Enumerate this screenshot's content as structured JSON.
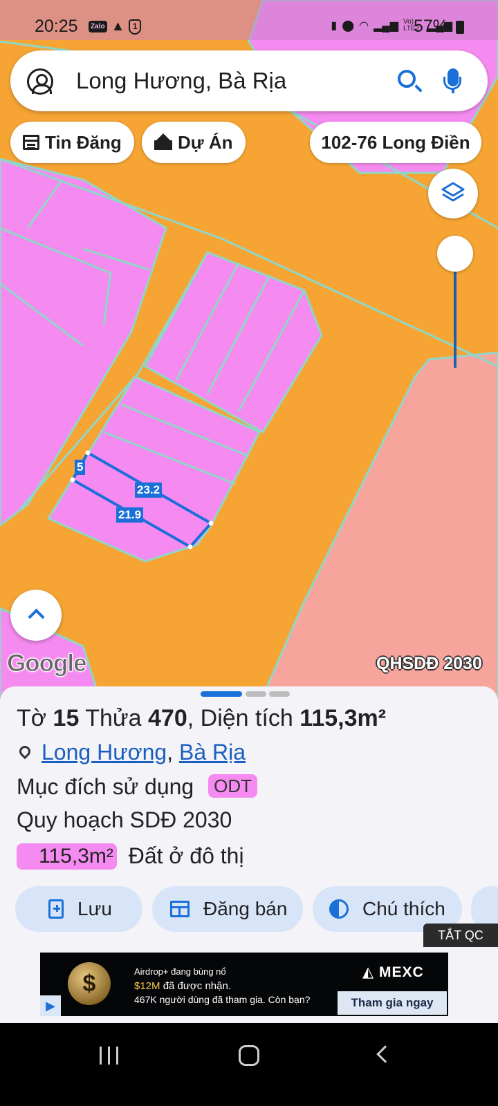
{
  "status_bar": {
    "time": "20:25",
    "app_badge": "Zalo",
    "shield_digit": "1",
    "signal_label": "Vo) LTE2",
    "battery": "57%"
  },
  "search": {
    "query": "Long Hương, Bà Rịa",
    "icons": [
      "account-icon",
      "search-icon",
      "mic-icon"
    ]
  },
  "chips": [
    {
      "label": "Tin Đăng",
      "icon": "calendar-icon"
    },
    {
      "label": "Dự Án",
      "icon": "house-icon"
    },
    {
      "label": "102-76 Long Điền"
    }
  ],
  "map": {
    "overlay_label": "QHSDĐ 2030",
    "google_logo": "Google",
    "measurements": [
      "5",
      "23.2",
      "21.9"
    ],
    "colors": {
      "residential": "#f58bf0",
      "road": "#f6a534",
      "other": "#f7a59c",
      "boundary": "#8fd7c8",
      "measure": "#1a6fd8"
    }
  },
  "parcel": {
    "sheet_prefix": "Tờ",
    "sheet_number": "15",
    "parcel_prefix": "Thửa",
    "parcel_number": "470",
    "area_prefix": ", Diện tích",
    "area": "115,3m²",
    "location_1": "Long Hương",
    "location_sep": ",",
    "location_2": "Bà Rịa",
    "purpose_label": "Mục đích sử dụng",
    "purpose_code": "ODT",
    "plan_label": "Quy hoạch SDĐ 2030",
    "plan_area": "115,3m²",
    "plan_landuse": "Đất ở đô thị"
  },
  "actions": [
    {
      "label": "Lưu",
      "icon": "save-icon"
    },
    {
      "label": "Đăng bán",
      "icon": "listing-icon"
    },
    {
      "label": "Chú thích",
      "icon": "legend-icon"
    }
  ],
  "ad_toggle": "TẮT QC",
  "ad": {
    "coin": "$",
    "line1": "Airdrop+ đang bùng nổ",
    "line2_highlight": "$12M",
    "line2_rest": " đã được nhận.",
    "line3": "467K người dùng đã tham gia. Còn bạn?",
    "brand": "◭ MEXC",
    "cta": "Tham gia ngay"
  }
}
